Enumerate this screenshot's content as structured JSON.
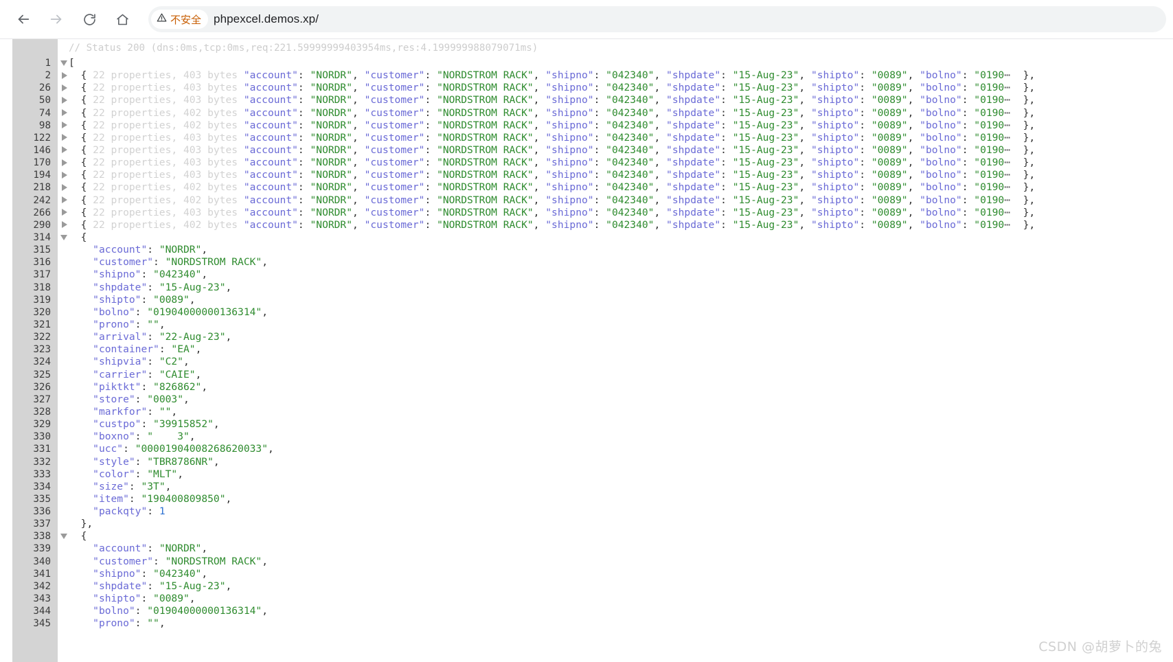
{
  "browser": {
    "back_icon": "arrow-left-icon",
    "forward_icon": "arrow-right-icon",
    "reload_icon": "reload-icon",
    "home_icon": "home-icon",
    "security_warning_icon": "warning-triangle-icon",
    "security_warning_label": "不安全",
    "url": "phpexcel.demos.xp/"
  },
  "viewer": {
    "status_comment": "// Status 200 (dns:0ms,tcp:0ms,req:221.59999999403954ms,res:4.199999988079071ms)",
    "watermark": "CSDN @胡萝卜的兔",
    "colors": {
      "key": "#6a6ad6",
      "string": "#2e8b2e",
      "number": "#2b6fd1",
      "dim": "#d2d2d2",
      "gutter": "#d4d4d4",
      "warning": "#c75c00"
    },
    "open_bracket": "[",
    "ellipsis": "⋯",
    "collapsed_rows": [
      {
        "line": "2",
        "summary": "22 properties, 403 bytes"
      },
      {
        "line": "26",
        "summary": "22 properties, 403 bytes"
      },
      {
        "line": "50",
        "summary": "22 properties, 403 bytes"
      },
      {
        "line": "74",
        "summary": "22 properties, 402 bytes"
      },
      {
        "line": "98",
        "summary": "22 properties, 402 bytes"
      },
      {
        "line": "122",
        "summary": "22 properties, 403 bytes"
      },
      {
        "line": "146",
        "summary": "22 properties, 403 bytes"
      },
      {
        "line": "170",
        "summary": "22 properties, 403 bytes"
      },
      {
        "line": "194",
        "summary": "22 properties, 403 bytes"
      },
      {
        "line": "218",
        "summary": "22 properties, 402 bytes"
      },
      {
        "line": "242",
        "summary": "22 properties, 402 bytes"
      },
      {
        "line": "266",
        "summary": "22 properties, 403 bytes"
      },
      {
        "line": "290",
        "summary": "22 properties, 402 bytes"
      }
    ],
    "preview_fields": {
      "account_key": "\"account\"",
      "account_value": "\"NORDR\"",
      "customer_key": "\"customer\"",
      "customer_value": "\"NORDSTROM RACK\"",
      "shipno_key": "\"shipno\"",
      "shipno_value": "\"042340\"",
      "shpdate_key": "\"shpdate\"",
      "shpdate_value": "\"15-Aug-23\"",
      "shipto_key": "\"shipto\"",
      "shipto_value": "\"0089\"",
      "bolno_key": "\"bolno\"",
      "bolno_value_truncated": "\"0190"
    },
    "expanded_object_1": {
      "open_line": "314",
      "close_line": "337",
      "rows": [
        {
          "line": "315",
          "key": "\"account\"",
          "value": "\"NORDR\"",
          "type": "string",
          "comma": true
        },
        {
          "line": "316",
          "key": "\"customer\"",
          "value": "\"NORDSTROM RACK\"",
          "type": "string",
          "comma": true
        },
        {
          "line": "317",
          "key": "\"shipno\"",
          "value": "\"042340\"",
          "type": "string",
          "comma": true
        },
        {
          "line": "318",
          "key": "\"shpdate\"",
          "value": "\"15-Aug-23\"",
          "type": "string",
          "comma": true
        },
        {
          "line": "319",
          "key": "\"shipto\"",
          "value": "\"0089\"",
          "type": "string",
          "comma": true
        },
        {
          "line": "320",
          "key": "\"bolno\"",
          "value": "\"01904000000136314\"",
          "type": "string",
          "comma": true
        },
        {
          "line": "321",
          "key": "\"prono\"",
          "value": "\"\"",
          "type": "string",
          "comma": true
        },
        {
          "line": "322",
          "key": "\"arrival\"",
          "value": "\"22-Aug-23\"",
          "type": "string",
          "comma": true
        },
        {
          "line": "323",
          "key": "\"container\"",
          "value": "\"EA\"",
          "type": "string",
          "comma": true
        },
        {
          "line": "324",
          "key": "\"shipvia\"",
          "value": "\"C2\"",
          "type": "string",
          "comma": true
        },
        {
          "line": "325",
          "key": "\"carrier\"",
          "value": "\"CAIE\"",
          "type": "string",
          "comma": true
        },
        {
          "line": "326",
          "key": "\"piktkt\"",
          "value": "\"826862\"",
          "type": "string",
          "comma": true
        },
        {
          "line": "327",
          "key": "\"store\"",
          "value": "\"0003\"",
          "type": "string",
          "comma": true
        },
        {
          "line": "328",
          "key": "\"markfor\"",
          "value": "\"\"",
          "type": "string",
          "comma": true
        },
        {
          "line": "329",
          "key": "\"custpo\"",
          "value": "\"39915852\"",
          "type": "string",
          "comma": true
        },
        {
          "line": "330",
          "key": "\"boxno\"",
          "value": "\"    3\"",
          "type": "string",
          "comma": true
        },
        {
          "line": "331",
          "key": "\"ucc\"",
          "value": "\"00001904008268620033\"",
          "type": "string",
          "comma": true
        },
        {
          "line": "332",
          "key": "\"style\"",
          "value": "\"TBR8786NR\"",
          "type": "string",
          "comma": true
        },
        {
          "line": "333",
          "key": "\"color\"",
          "value": "\"MLT\"",
          "type": "string",
          "comma": true
        },
        {
          "line": "334",
          "key": "\"size\"",
          "value": "\"3T\"",
          "type": "string",
          "comma": true
        },
        {
          "line": "335",
          "key": "\"item\"",
          "value": "\"190400809850\"",
          "type": "string",
          "comma": true
        },
        {
          "line": "336",
          "key": "\"packqty\"",
          "value": "1",
          "type": "number",
          "comma": false
        }
      ]
    },
    "expanded_object_2": {
      "open_line": "338",
      "rows": [
        {
          "line": "339",
          "key": "\"account\"",
          "value": "\"NORDR\"",
          "type": "string",
          "comma": true
        },
        {
          "line": "340",
          "key": "\"customer\"",
          "value": "\"NORDSTROM RACK\"",
          "type": "string",
          "comma": true
        },
        {
          "line": "341",
          "key": "\"shipno\"",
          "value": "\"042340\"",
          "type": "string",
          "comma": true
        },
        {
          "line": "342",
          "key": "\"shpdate\"",
          "value": "\"15-Aug-23\"",
          "type": "string",
          "comma": true
        },
        {
          "line": "343",
          "key": "\"shipto\"",
          "value": "\"0089\"",
          "type": "string",
          "comma": true
        },
        {
          "line": "344",
          "key": "\"bolno\"",
          "value": "\"01904000000136314\"",
          "type": "string",
          "comma": true
        },
        {
          "line": "345",
          "key": "\"prono\"",
          "value": "\"\"",
          "type": "string",
          "comma": true
        }
      ]
    }
  }
}
